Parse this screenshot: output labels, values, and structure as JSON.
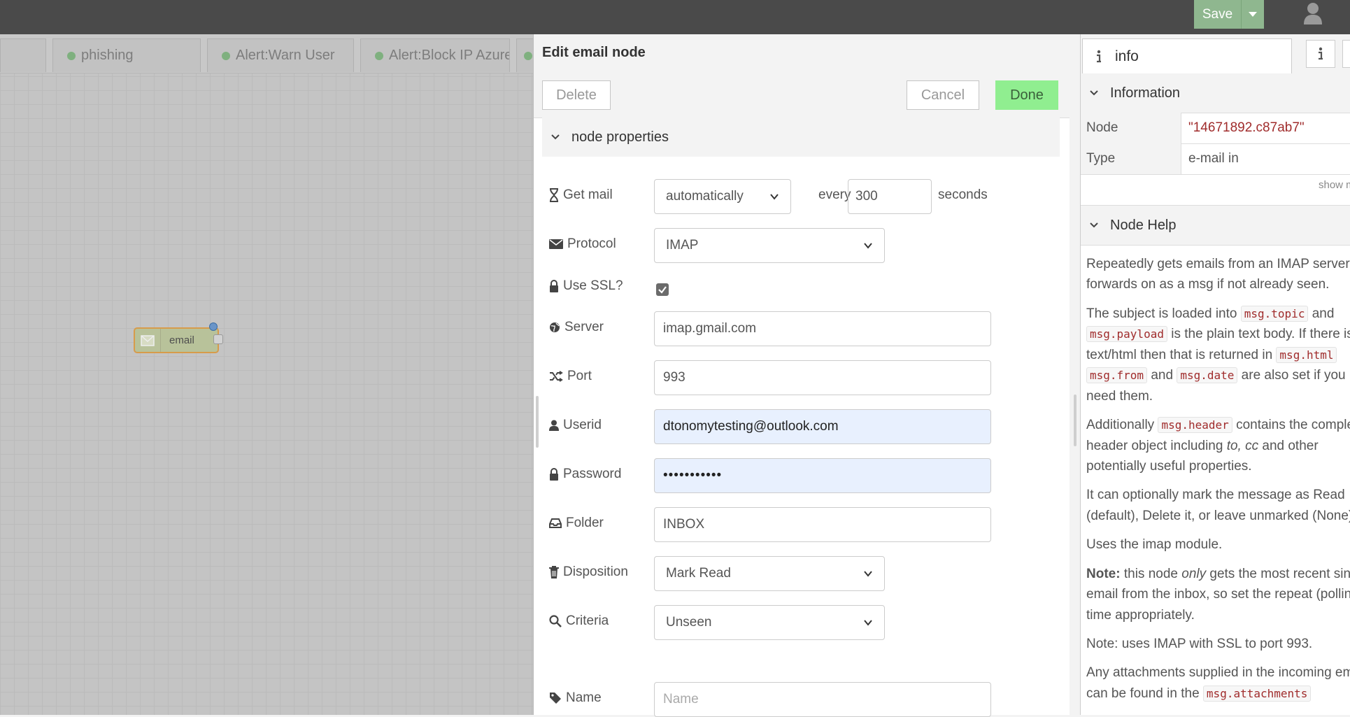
{
  "header": {
    "save_label": "Save"
  },
  "workspace": {
    "tabs": [
      "phishing",
      "Alert:Warn User",
      "Alert:Block IP Azure"
    ],
    "node_label": "email"
  },
  "editor": {
    "title": "Edit email node",
    "delete_label": "Delete",
    "cancel_label": "Cancel",
    "done_label": "Done",
    "section_label": "node properties",
    "get_mail": {
      "label": "Get mail",
      "value": "automatically",
      "every_label": "every",
      "interval": "300",
      "unit": "seconds"
    },
    "protocol": {
      "label": "Protocol",
      "value": "IMAP"
    },
    "use_ssl": {
      "label": "Use SSL?",
      "checked": true
    },
    "server": {
      "label": "Server",
      "value": "imap.gmail.com"
    },
    "port": {
      "label": "Port",
      "value": "993"
    },
    "userid": {
      "label": "Userid",
      "value": "dtonomytesting@outlook.com"
    },
    "password": {
      "label": "Password",
      "value": "•••••••••••"
    },
    "folder": {
      "label": "Folder",
      "value": "INBOX"
    },
    "disposition": {
      "label": "Disposition",
      "value": "Mark Read"
    },
    "criteria": {
      "label": "Criteria",
      "value": "Unseen"
    },
    "name": {
      "label": "Name",
      "placeholder": "Name"
    }
  },
  "sidebar": {
    "tab_label": "info",
    "information_label": "Information",
    "node_key": "Node",
    "node_value": "\"14671892.c87ab7\"",
    "type_key": "Type",
    "type_value": "e-mail in",
    "show_more": "show more",
    "help_label": "Node Help",
    "help": {
      "p1a": "Repeatedly gets emails from an IMAP server and",
      "p1b": "forwards on as a msg if not already seen.",
      "p2a": "The subject is loaded into",
      "c_topic": "msg.topic",
      "p2b": "and",
      "c_payload": "msg.payload",
      "p2c": "is the plain text body. If there is",
      "p2d": "text/html then that is returned in",
      "c_html": "msg.html",
      "c_from": "msg.from",
      "p2e": "and",
      "c_date": "msg.date",
      "p2f": "are also set if you",
      "p2g": "need them.",
      "p3a": "Additionally",
      "c_header": "msg.header",
      "p3b": "contains the complete",
      "p3c": "header object including",
      "p3d": "to, cc",
      "p3e": "and other",
      "p3f": "potentially useful properties.",
      "p4a": "It can optionally mark the message as Read",
      "p4b": "(default), Delete it, or leave unmarked (None).",
      "p5": "Uses the imap module.",
      "p6_note": "Note:",
      "p6a": "this node",
      "p6_only": "only",
      "p6b": "gets the most recent single",
      "p6c": "email from the inbox, so set the repeat (polling)",
      "p6d": "time appropriately.",
      "p7": "Note: uses IMAP with SSL to port 993.",
      "p8a": "Any attachments supplied in the incoming email",
      "p8b": "can be found in the",
      "c_attach": "msg.attachments"
    }
  }
}
